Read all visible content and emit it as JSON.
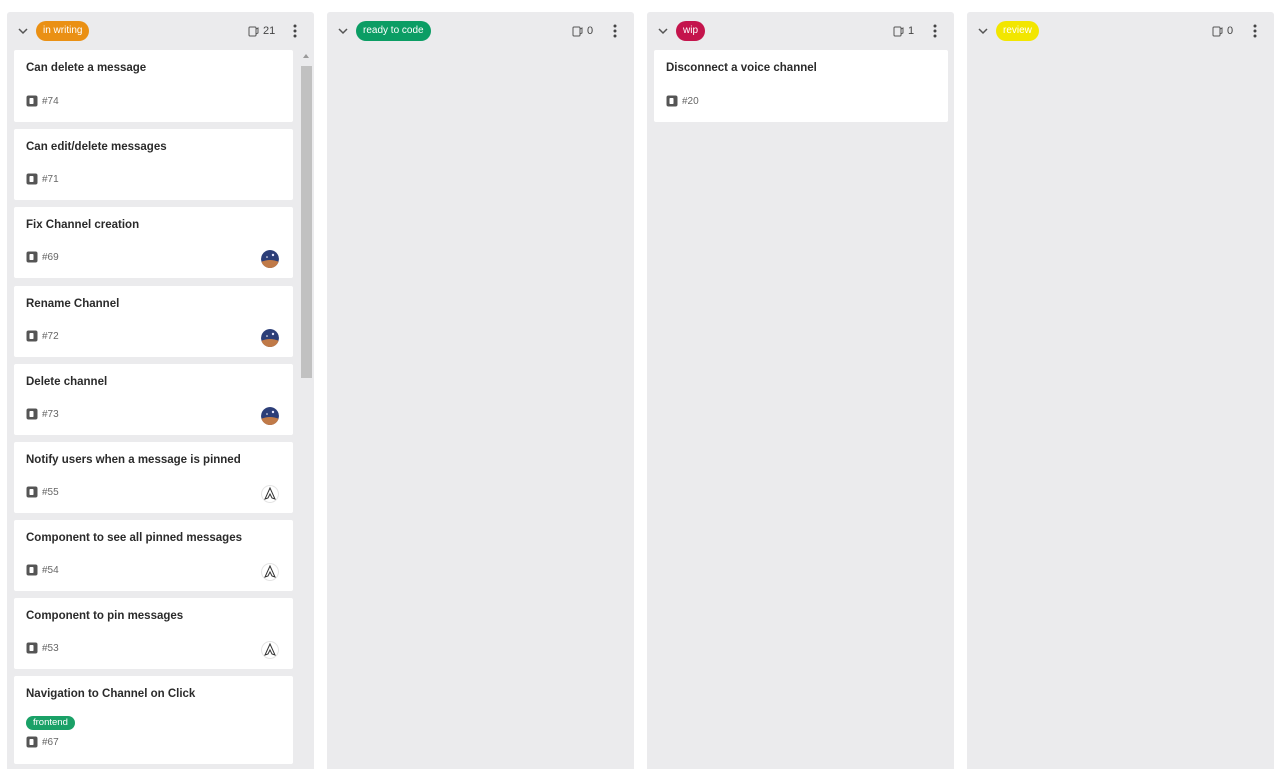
{
  "colors": {
    "column_bg": "#ebebed",
    "in_writing": "#ea9014",
    "ready_to_code": "#0b9d64",
    "wip": "#c4144c",
    "review": "#f2e600",
    "frontend": "#1aa167"
  },
  "columns": [
    {
      "status": "in writing",
      "count": "21",
      "cards": [
        {
          "title": "Can delete a message",
          "id": "#74",
          "avatar": ""
        },
        {
          "title": "Can edit/delete messages",
          "id": "#71",
          "avatar": ""
        },
        {
          "title": "Fix Channel creation",
          "id": "#69",
          "avatar": "space-avatar"
        },
        {
          "title": "Rename Channel",
          "id": "#72",
          "avatar": "space-avatar"
        },
        {
          "title": "Delete channel",
          "id": "#73",
          "avatar": "space-avatar"
        },
        {
          "title": "Notify users when a message is pinned",
          "id": "#55",
          "avatar": "emblem-avatar"
        },
        {
          "title": "Component to see all pinned messages",
          "id": "#54",
          "avatar": "emblem-avatar"
        },
        {
          "title": "Component to pin messages",
          "id": "#53",
          "avatar": "emblem-avatar"
        },
        {
          "title": "Navigation to Channel on Click",
          "id": "#67",
          "avatar": "",
          "label": "frontend"
        }
      ]
    },
    {
      "status": "ready to code",
      "count": "0",
      "cards": []
    },
    {
      "status": "wip",
      "count": "1",
      "cards": [
        {
          "title": "Disconnect a voice channel",
          "id": "#20",
          "avatar": ""
        }
      ]
    },
    {
      "status": "review",
      "count": "0",
      "cards": []
    }
  ]
}
